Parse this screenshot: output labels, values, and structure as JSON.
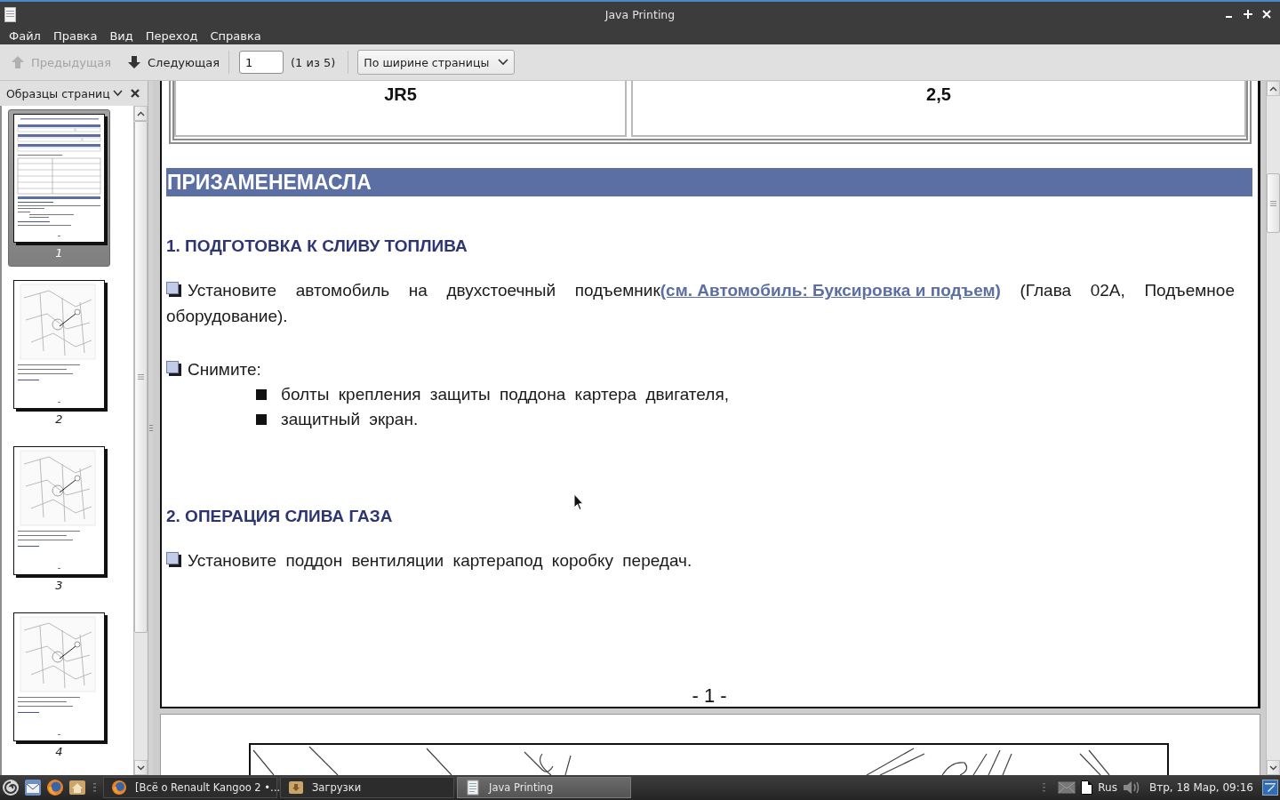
{
  "window": {
    "title": "Java Printing"
  },
  "menu": [
    {
      "label": "Файл"
    },
    {
      "label": "Правка"
    },
    {
      "label": "Вид"
    },
    {
      "label": "Переход"
    },
    {
      "label": "Справка"
    }
  ],
  "toolbar": {
    "previous": {
      "label": "Предыдущая",
      "disabled": true
    },
    "next": {
      "label": "Следующая",
      "disabled": false
    },
    "page_field": {
      "value": "1"
    },
    "page_count": "(1 из 5)",
    "zoom_select": {
      "value": "По ширине страницы"
    }
  },
  "sidebar": {
    "title": "Образцы страниц",
    "thumbnails": [
      {
        "label": "1",
        "kind": "text",
        "selected": true
      },
      {
        "label": "2",
        "kind": "figure",
        "selected": false
      },
      {
        "label": "3",
        "kind": "figure",
        "selected": false
      },
      {
        "label": "4",
        "kind": "figure",
        "selected": false
      }
    ]
  },
  "document": {
    "table_row": [
      {
        "text": "JR5"
      },
      {
        "text": "2,5"
      }
    ],
    "banner": "ПРИЗАМЕНЕМАСЛА",
    "blocks": [
      {
        "kind": "heading",
        "text": "1. ПОДГОТОВКА К СЛИВУ ТОПЛИВА"
      },
      {
        "kind": "step",
        "text": "Установите автомобиль на двухстоечный подъемник",
        "link": "(см. Автомобиль: Буксировка и подъем)",
        "text_after": "(Глава 02A, Подъемное оборудование)."
      },
      {
        "kind": "step",
        "text": "Снимите:",
        "items": [
          "болты крепления защиты поддона картера двигателя,",
          "защитный экран."
        ]
      },
      {
        "kind": "heading",
        "text": "2. ОПЕРАЦИЯ СЛИВА ГАЗА"
      },
      {
        "kind": "step",
        "text": "Установите поддон вентиляции картерапод коробку передач."
      }
    ],
    "page_number": "- 1 -"
  },
  "taskbar": {
    "tasks": [
      {
        "label": "[Всё о Renault Kangoo 2 •...",
        "kind": "browser",
        "selected": false
      },
      {
        "label": "Загрузки",
        "kind": "folder",
        "selected": false
      },
      {
        "label": "Java Printing",
        "kind": "document",
        "selected": true
      }
    ],
    "keyboard_layout": "Rus",
    "clock": "Втр, 18 Мар, 09:16"
  }
}
